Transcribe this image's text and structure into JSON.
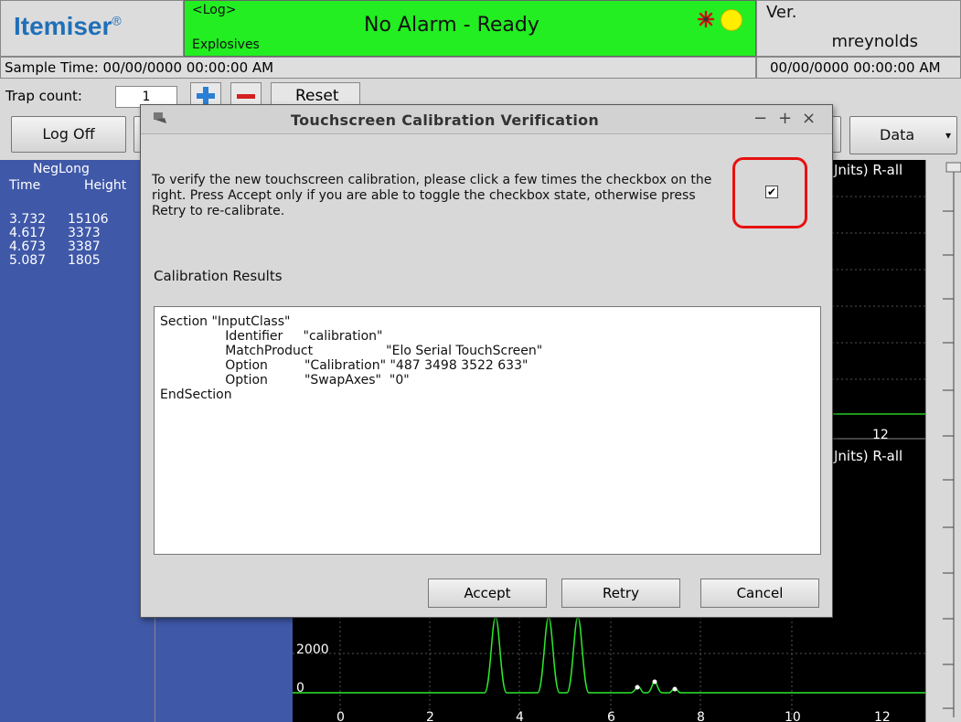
{
  "header": {
    "logo": "Itemiser",
    "logo_mark": "®",
    "status_log": "<Log>",
    "status_type": "Explosives",
    "status_main": "No Alarm - Ready",
    "ver_label": "Ver.",
    "user": "mreynolds",
    "sample_time": "Sample Time: 00/00/0000  00:00:00 AM",
    "date_time": "00/00/0000  00:00:00 AM",
    "status_color": "#22ee22"
  },
  "toolbar": {
    "trap_label": "Trap count:",
    "trap_value": "1",
    "reset_label": "Reset",
    "logoff_label": "Log Off",
    "data_label": "Data"
  },
  "neg_panel": {
    "title": "NegLong",
    "col_time": "Time",
    "col_height": "Height",
    "rows": [
      {
        "time": "3.732",
        "height": "15106"
      },
      {
        "time": "4.617",
        "height": "3373"
      },
      {
        "time": "4.673",
        "height": "3387"
      },
      {
        "time": "5.087",
        "height": "1805"
      }
    ]
  },
  "charts": {
    "upper_label": "Jnits) R-all",
    "upper_tick_right": "12",
    "lower_label": "Jnits) R-all",
    "y_tick_2000": "2000",
    "y_tick_0": "0",
    "x_ticks": [
      "0",
      "2",
      "4",
      "6",
      "8",
      "10",
      "12"
    ]
  },
  "dialog": {
    "title": "Touchscreen Calibration Verification",
    "message": "To verify the new touchscreen calibration, please click a few times the checkbox on the right. Press Accept only if you are able to toggle the checkbox state, otherwise press Retry to re-calibrate.",
    "checkbox_checked": true,
    "results_label": "Calibration Results",
    "results_lines": [
      "Section \"InputClass\"",
      "                Identifier     \"calibration\"",
      "                MatchProduct                  \"Elo Serial TouchScreen\"",
      "                Option         \"Calibration\" \"487 3498 3522 633\"",
      "                Option         \"SwapAxes\"  \"0\"",
      "EndSection"
    ],
    "accept_label": "Accept",
    "retry_label": "Retry",
    "cancel_label": "Cancel",
    "minimize_glyph": "−",
    "maximize_glyph": "+",
    "close_glyph": "×"
  }
}
